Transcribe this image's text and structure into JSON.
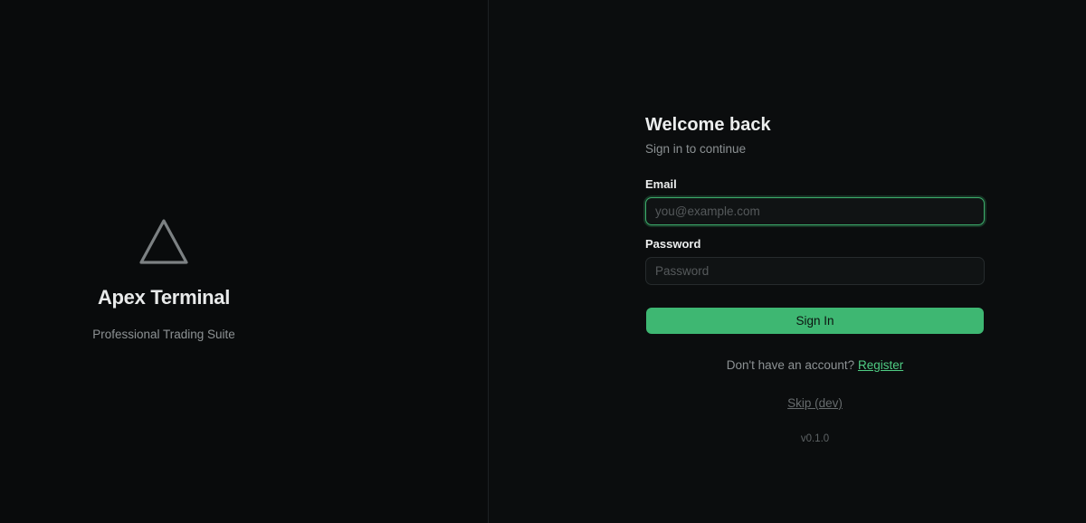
{
  "brand": {
    "icon": "triangle-icon",
    "title": "Apex Terminal",
    "subtitle": "Professional Trading Suite"
  },
  "login": {
    "title": "Welcome back",
    "subtitle": "Sign in to continue",
    "email": {
      "label": "Email",
      "placeholder": "you@example.com",
      "value": ""
    },
    "password": {
      "label": "Password",
      "placeholder": "Password",
      "value": ""
    },
    "submit_label": "Sign In",
    "register_prompt": "Don't have an account?",
    "register_link": "Register",
    "skip_link": "Skip (dev)",
    "version": "v0.1.0"
  },
  "colors": {
    "accent": "#3eb772",
    "link": "#4fcd84",
    "background": "#0a0c0d"
  }
}
